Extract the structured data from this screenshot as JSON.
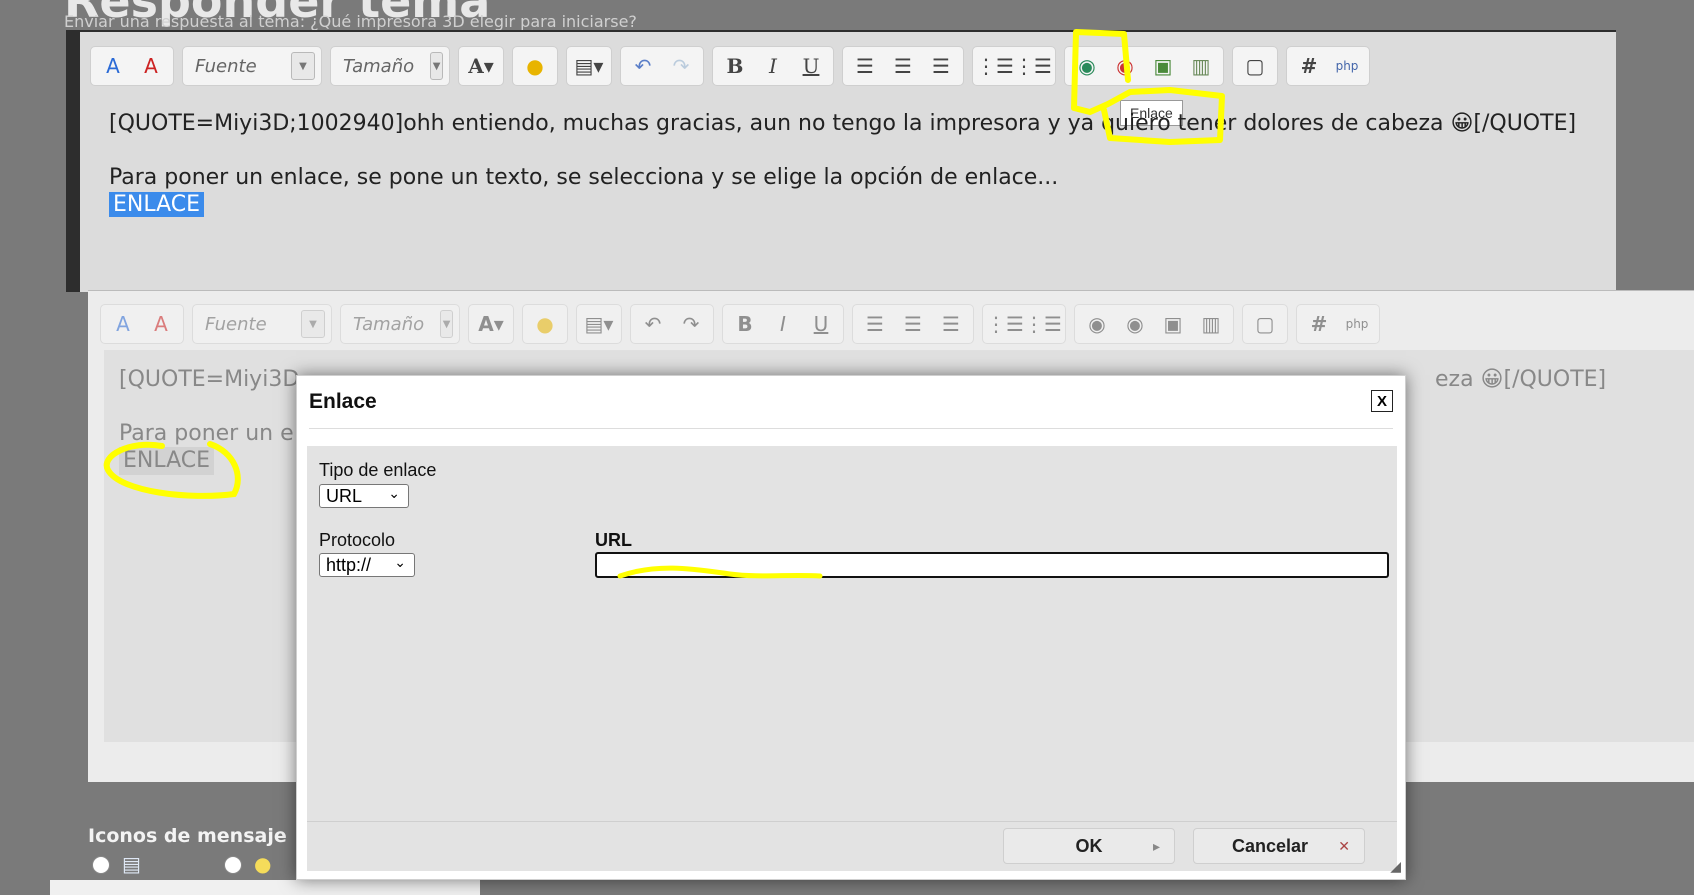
{
  "page": {
    "title": "Responder tema",
    "subtitle": "Enviar una respuesta al tema: ¿Qué impresora 3D elegir para iniciarse?"
  },
  "toolbar": {
    "font_label": "Fuente",
    "size_label": "Tamaño",
    "bold": "B",
    "italic": "I",
    "underline": "U",
    "hash": "#",
    "tooltip": "Enlace"
  },
  "editor": {
    "line1": "[QUOTE=Miyi3D;1002940]ohh entiendo, muchas gracias, aun no tengo la impresora y ya quiero tener dolores de cabeza 😀[/QUOTE]",
    "line2": "Para poner un enlace, se pone un texto, se selecciona y se elige la opción de enlace...",
    "line3": "ENLACE"
  },
  "editor_bg": {
    "line1_a": "[QUOTE=Miyi3D",
    "line1_b": "eza 😀[/QUOTE]",
    "line2": "Para poner un e",
    "line3": "ENLACE"
  },
  "dialog": {
    "title": "Enlace",
    "close": "X",
    "link_type_label": "Tipo de enlace",
    "link_type_value": "URL",
    "protocol_label": "Protocolo",
    "protocol_value": "http://",
    "url_label": "URL",
    "url_value": "",
    "ok_label": "OK",
    "cancel_label": "Cancelar"
  },
  "bottom": {
    "icons_label": "Iconos de mensaje"
  },
  "colors": {
    "selection": "#3b8beb",
    "annotation": "#ffff00"
  }
}
